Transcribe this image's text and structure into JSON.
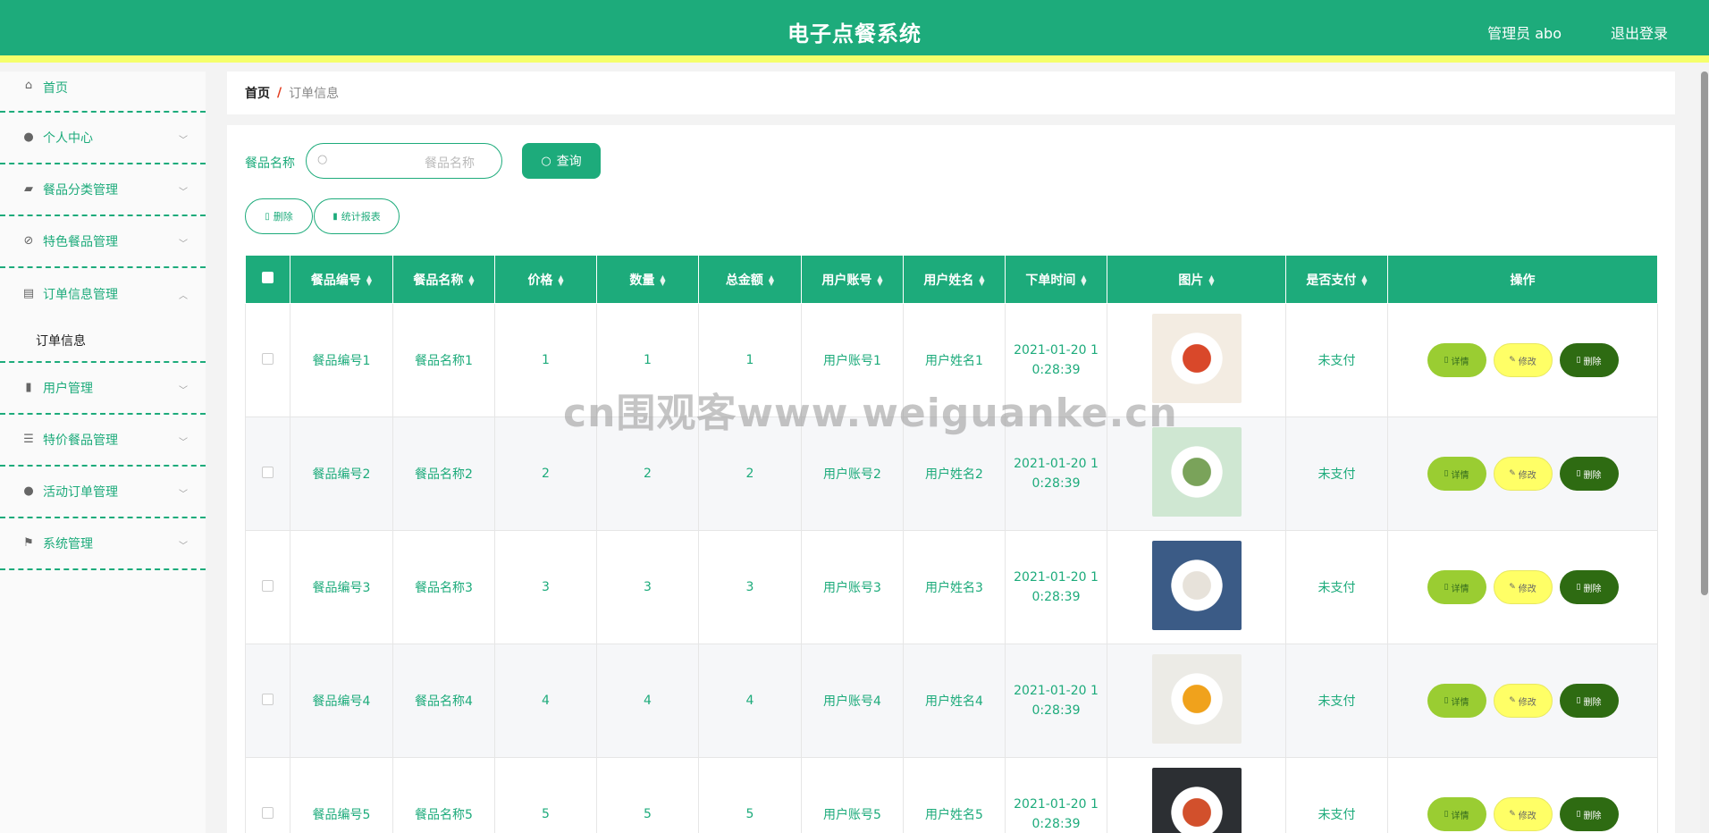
{
  "header": {
    "title": "电子点餐系统",
    "user": "管理员 abo",
    "logout": "退出登录"
  },
  "sidebar": {
    "items": [
      {
        "label": "首页",
        "icon": "home-icon"
      },
      {
        "label": "个人中心",
        "icon": "user-icon"
      },
      {
        "label": "餐品分类管理",
        "icon": "wallet-icon"
      },
      {
        "label": "特色餐品管理",
        "icon": "bell-off-icon"
      },
      {
        "label": "订单信息管理",
        "icon": "clipboard-icon",
        "expanded": true,
        "sub": "订单信息"
      },
      {
        "label": "用户管理",
        "icon": "bar-chart-icon"
      },
      {
        "label": "特价餐品管理",
        "icon": "sliders-icon"
      },
      {
        "label": "活动订单管理",
        "icon": "user-icon"
      },
      {
        "label": "系统管理",
        "icon": "flag-icon"
      }
    ]
  },
  "breadcrumb": {
    "home": "首页",
    "separator": "/",
    "current": "订单信息"
  },
  "search": {
    "label": "餐品名称",
    "placeholder": "餐品名称",
    "button": "查询"
  },
  "actions": {
    "delete": "删除",
    "report": "统计报表"
  },
  "table": {
    "headers": [
      "餐品编号",
      "餐品名称",
      "价格",
      "数量",
      "总金额",
      "用户账号",
      "用户姓名",
      "下单时间",
      "图片",
      "是否支付",
      "操作"
    ],
    "op_labels": {
      "detail": "详情",
      "edit": "修改",
      "delete": "删除"
    },
    "rows": [
      {
        "code": "餐品编号1",
        "name": "餐品名称1",
        "price": "1",
        "qty": "1",
        "total": "1",
        "account": "用户账号1",
        "username": "用户姓名1",
        "time": "2021-01-20 10:28:39",
        "paid": "未支付",
        "image_colors": [
          "#f3ece2",
          "#d9482a"
        ]
      },
      {
        "code": "餐品编号2",
        "name": "餐品名称2",
        "price": "2",
        "qty": "2",
        "total": "2",
        "account": "用户账号2",
        "username": "用户姓名2",
        "time": "2021-01-20 10:28:39",
        "paid": "未支付",
        "image_colors": [
          "#cfe7d2",
          "#7aa35a"
        ]
      },
      {
        "code": "餐品编号3",
        "name": "餐品名称3",
        "price": "3",
        "qty": "3",
        "total": "3",
        "account": "用户账号3",
        "username": "用户姓名3",
        "time": "2021-01-20 10:28:39",
        "paid": "未支付",
        "image_colors": [
          "#3b5b86",
          "#e7e2da"
        ]
      },
      {
        "code": "餐品编号4",
        "name": "餐品名称4",
        "price": "4",
        "qty": "4",
        "total": "4",
        "account": "用户账号4",
        "username": "用户姓名4",
        "time": "2021-01-20 10:28:39",
        "paid": "未支付",
        "image_colors": [
          "#ecebe6",
          "#f0a21c"
        ]
      },
      {
        "code": "餐品编号5",
        "name": "餐品名称5",
        "price": "5",
        "qty": "5",
        "total": "5",
        "account": "用户账号5",
        "username": "用户姓名5",
        "time": "2021-01-20 10:28:39",
        "paid": "未支付",
        "image_colors": [
          "#2c2f33",
          "#d2502c"
        ]
      }
    ]
  },
  "watermark": "cn围观客www.weiguanke.cn"
}
